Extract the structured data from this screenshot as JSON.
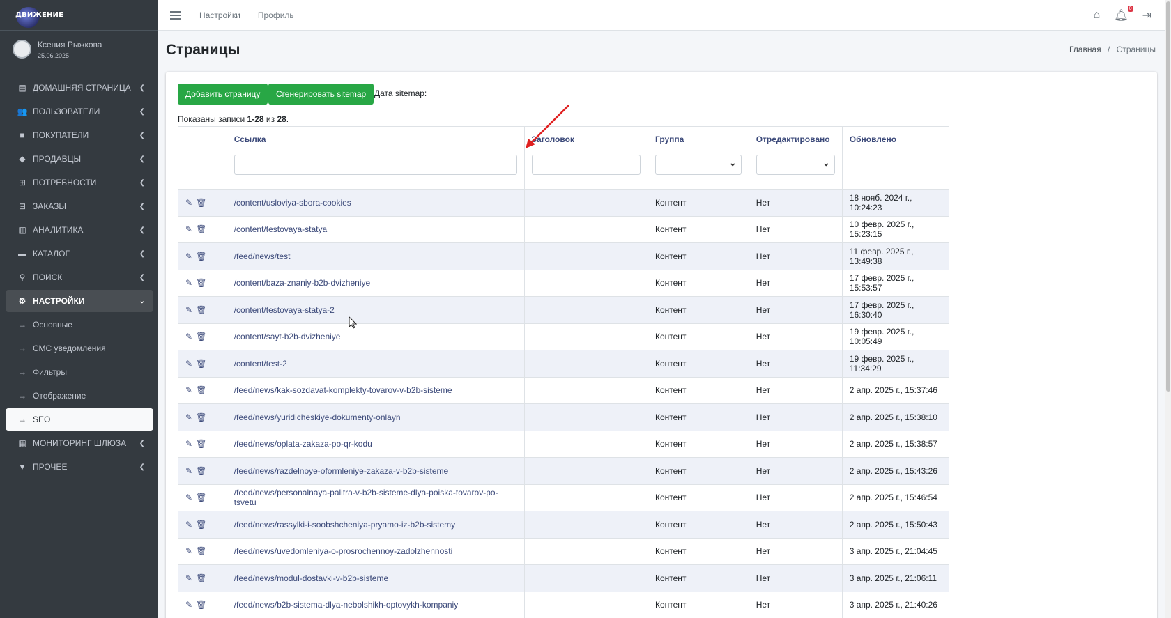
{
  "brand": {
    "name": "ДВИЖЕНИЕ"
  },
  "user": {
    "name": "Ксения Рыжкова",
    "date": "25.06.2025"
  },
  "sidebar": {
    "items": [
      {
        "label": "ДОМАШНЯЯ СТРАНИЦА",
        "icon": "table-icon"
      },
      {
        "label": "ПОЛЬЗОВАТЕЛИ",
        "icon": "users-icon"
      },
      {
        "label": "ПОКУПАТЕЛИ",
        "icon": "briefcase-icon"
      },
      {
        "label": "ПРОДАВЦЫ",
        "icon": "tag-icon"
      },
      {
        "label": "ПОТРЕБНОСТИ",
        "icon": "cart-plus-icon"
      },
      {
        "label": "ЗАКАЗЫ",
        "icon": "cart-icon"
      },
      {
        "label": "АНАЛИТИКА",
        "icon": "chart-icon"
      },
      {
        "label": "КАТАЛОГ",
        "icon": "folder-icon"
      },
      {
        "label": "ПОИСК",
        "icon": "search-icon"
      },
      {
        "label": "НАСТРОЙКИ",
        "icon": "cogs-icon"
      }
    ],
    "sub_items": [
      {
        "label": "Основные"
      },
      {
        "label": "СМС уведомления"
      },
      {
        "label": "Фильтры"
      },
      {
        "label": "Отображение"
      },
      {
        "label": "SEO"
      }
    ],
    "bottom_items": [
      {
        "label": "МОНИТОРИНГ ШЛЮЗА",
        "icon": "table-icon"
      },
      {
        "label": "ПРОЧЕЕ",
        "icon": "caret-square-icon"
      }
    ]
  },
  "topbar": {
    "settings_link": "Настройки",
    "profile_link": "Профиль",
    "notification_count": "0"
  },
  "header": {
    "title": "Страницы",
    "breadcrumb_home": "Главная",
    "breadcrumb_sep": "/",
    "breadcrumb_current": "Страницы"
  },
  "toolbar": {
    "add_label": "Добавить страницу",
    "generate_label": "Сгенерировать sitemap",
    "sitemap_date_label": "Дата sitemap:"
  },
  "summary": {
    "prefix": "Показаны записи ",
    "range": "1-28",
    "middle": " из ",
    "total": "28",
    "suffix": "."
  },
  "table": {
    "columns": [
      "Ссылка",
      "Заголовок",
      "Группа",
      "Отредактировано",
      "Обновлено"
    ],
    "rows": [
      {
        "link": "/content/usloviya-sbora-cookies",
        "title": "",
        "group": "Контент",
        "edited": "Нет",
        "updated": "18 нояб. 2024 г., 10:24:23"
      },
      {
        "link": "/content/testovaya-statya",
        "title": "",
        "group": "Контент",
        "edited": "Нет",
        "updated": "10 февр. 2025 г., 15:23:15"
      },
      {
        "link": "/feed/news/test",
        "title": "",
        "group": "Контент",
        "edited": "Нет",
        "updated": "11 февр. 2025 г., 13:49:38"
      },
      {
        "link": "/content/baza-znaniy-b2b-dvizheniye",
        "title": "",
        "group": "Контент",
        "edited": "Нет",
        "updated": "17 февр. 2025 г., 15:53:57"
      },
      {
        "link": "/content/testovaya-statya-2",
        "title": "",
        "group": "Контент",
        "edited": "Нет",
        "updated": "17 февр. 2025 г., 16:30:40"
      },
      {
        "link": "/content/sayt-b2b-dvizheniye",
        "title": "",
        "group": "Контент",
        "edited": "Нет",
        "updated": "19 февр. 2025 г., 10:05:49"
      },
      {
        "link": "/content/test-2",
        "title": "",
        "group": "Контент",
        "edited": "Нет",
        "updated": "19 февр. 2025 г., 11:34:29"
      },
      {
        "link": "/feed/news/kak-sozdavat-komplekty-tovarov-v-b2b-sisteme",
        "title": "",
        "group": "Контент",
        "edited": "Нет",
        "updated": "2 апр. 2025 г., 15:37:46"
      },
      {
        "link": "/feed/news/yuridicheskiye-dokumenty-onlayn",
        "title": "",
        "group": "Контент",
        "edited": "Нет",
        "updated": "2 апр. 2025 г., 15:38:10"
      },
      {
        "link": "/feed/news/oplata-zakaza-po-qr-kodu",
        "title": "",
        "group": "Контент",
        "edited": "Нет",
        "updated": "2 апр. 2025 г., 15:38:57"
      },
      {
        "link": "/feed/news/razdelnoye-oformleniye-zakaza-v-b2b-sisteme",
        "title": "",
        "group": "Контент",
        "edited": "Нет",
        "updated": "2 апр. 2025 г., 15:43:26"
      },
      {
        "link": "/feed/news/personalnaya-palitra-v-b2b-sisteme-dlya-poiska-tovarov-po-tsvetu",
        "title": "",
        "group": "Контент",
        "edited": "Нет",
        "updated": "2 апр. 2025 г., 15:46:54"
      },
      {
        "link": "/feed/news/rassylki-i-soobshcheniya-pryamo-iz-b2b-sistemy",
        "title": "",
        "group": "Контент",
        "edited": "Нет",
        "updated": "2 апр. 2025 г., 15:50:43"
      },
      {
        "link": "/feed/news/uvedomleniya-o-prosrochennoy-zadolzhennosti",
        "title": "",
        "group": "Контент",
        "edited": "Нет",
        "updated": "3 апр. 2025 г., 21:04:45"
      },
      {
        "link": "/feed/news/modul-dostavki-v-b2b-sisteme",
        "title": "",
        "group": "Контент",
        "edited": "Нет",
        "updated": "3 апр. 2025 г., 21:06:11"
      },
      {
        "link": "/feed/news/b2b-sistema-dlya-nebolshikh-optovykh-kompaniy",
        "title": "",
        "group": "Контент",
        "edited": "Нет",
        "updated": "3 апр. 2025 г., 21:40:26"
      }
    ]
  },
  "colors": {
    "accent_green": "#28a745",
    "sidebar_bg": "#343a40",
    "link": "#3c4a7a",
    "annotation_arrow": "#e02020"
  }
}
